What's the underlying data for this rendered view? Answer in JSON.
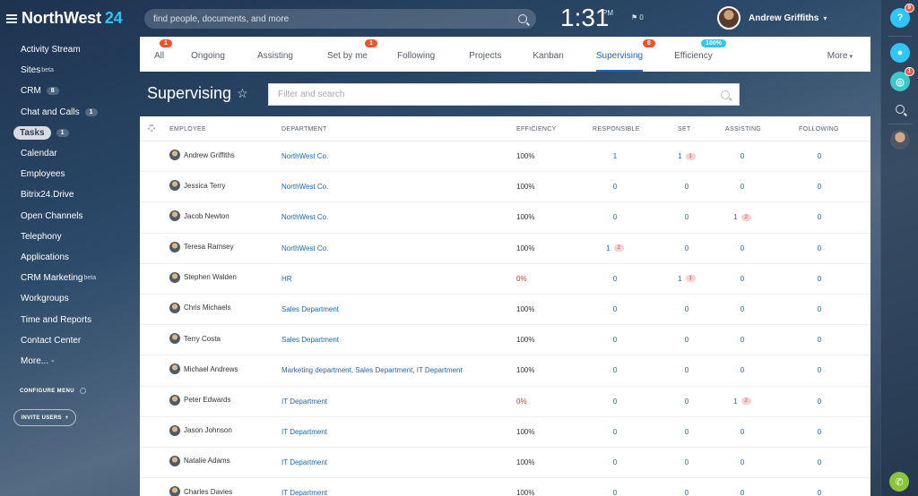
{
  "header": {
    "logo_name": "NorthWest",
    "logo_num": "24",
    "search_placeholder": "find people, documents, and more",
    "clock": "1:31",
    "ampm": "PM",
    "flag_count": "0",
    "user_name": "Andrew Griffiths"
  },
  "menu": [
    {
      "label": "Activity Stream"
    },
    {
      "label": "Sites",
      "sup": "beta"
    },
    {
      "label": "CRM",
      "count": "8"
    },
    {
      "label": "Chat and Calls",
      "count": "1"
    },
    {
      "label": "Tasks",
      "count": "1",
      "active": true
    },
    {
      "label": "Calendar"
    },
    {
      "label": "Employees"
    },
    {
      "label": "Bitrix24.Drive"
    },
    {
      "label": "Open Channels"
    },
    {
      "label": "Telephony"
    },
    {
      "label": "Applications"
    },
    {
      "label": "CRM Marketing",
      "sup": "beta"
    },
    {
      "label": "Workgroups"
    },
    {
      "label": "Time and Reports"
    },
    {
      "label": "Contact Center"
    },
    {
      "label": "More...",
      "caret": "-"
    }
  ],
  "configure_menu": "CONFIGURE MENU",
  "invite_users": "INVITE USERS",
  "invite_plus": "+",
  "tabs": [
    {
      "label": "All",
      "badge": "1"
    },
    {
      "label": "Ongoing"
    },
    {
      "label": "Assisting"
    },
    {
      "label": "Set by me",
      "badge": "1"
    },
    {
      "label": "Following"
    },
    {
      "label": "Projects"
    },
    {
      "label": "Kanban"
    },
    {
      "label": "Supervising",
      "badge": "8",
      "active": true
    },
    {
      "label": "Efficiency",
      "badge": "100%",
      "badge_color": "blue"
    },
    {
      "label": "More",
      "caret": "▾"
    }
  ],
  "page": {
    "title": "Supervising",
    "filter_placeholder": "Filter and search"
  },
  "right_bar": {
    "help_badge": "9",
    "chat_badge": "1"
  },
  "table": {
    "headers": [
      "EMPLOYEE",
      "DEPARTMENT",
      "EFFICIENCY",
      "RESPONSIBLE",
      "SET",
      "ASSISTING",
      "FOLLOWING"
    ],
    "rows": [
      {
        "employee": "Andrew Griffiths",
        "department": "NorthWest Co.",
        "efficiency": "100%",
        "responsible": "1",
        "set": "1",
        "set_pill": "1",
        "assisting": "0",
        "following": "0"
      },
      {
        "employee": "Jessica Terry",
        "department": "NorthWest Co.",
        "efficiency": "100%",
        "responsible": "0",
        "set": "0",
        "assisting": "0",
        "following": "0"
      },
      {
        "employee": "Jacob Newton",
        "department": "NorthWest Co.",
        "efficiency": "100%",
        "responsible": "0",
        "set": "0",
        "assisting": "1",
        "assisting_pill": "2",
        "following": "0"
      },
      {
        "employee": "Teresa Ramsey",
        "department": "NorthWest Co.",
        "efficiency": "100%",
        "responsible": "1",
        "responsible_pill": "2",
        "set": "0",
        "assisting": "0",
        "following": "0"
      },
      {
        "employee": "Stephen Walden",
        "department": "HR",
        "efficiency": "0%",
        "eff_red": true,
        "responsible": "0",
        "set": "1",
        "set_pill": "1",
        "assisting": "0",
        "following": "0"
      },
      {
        "employee": "Chris Michaels",
        "department": "Sales Department",
        "efficiency": "100%",
        "responsible": "0",
        "set": "0",
        "assisting": "0",
        "following": "0"
      },
      {
        "employee": "Terry Costa",
        "department": "Sales Department",
        "efficiency": "100%",
        "responsible": "0",
        "set": "0",
        "assisting": "0",
        "following": "0"
      },
      {
        "employee": "Michael Andrews",
        "department": "Marketing department, Sales Department, IT Department",
        "efficiency": "100%",
        "responsible": "0",
        "set": "0",
        "assisting": "0",
        "following": "0"
      },
      {
        "employee": "Peter Edwards",
        "department": "IT Department",
        "efficiency": "0%",
        "eff_red": true,
        "responsible": "0",
        "set": "0",
        "assisting": "1",
        "assisting_pill": "2",
        "following": "0"
      },
      {
        "employee": "Jason Johnson",
        "department": "IT Department",
        "efficiency": "100%",
        "responsible": "0",
        "set": "0",
        "assisting": "0",
        "following": "0"
      },
      {
        "employee": "Natalie Adams",
        "department": "IT Department",
        "efficiency": "100%",
        "responsible": "0",
        "set": "0",
        "assisting": "0",
        "following": "0"
      },
      {
        "employee": "Charles Davies",
        "department": "IT Department",
        "efficiency": "100%",
        "responsible": "0",
        "set": "0",
        "assisting": "0",
        "following": "0"
      }
    ]
  },
  "colors": {
    "accent": "#2067b0",
    "badge_red": "#f0522b",
    "badge_blue": "#2fc6f6",
    "logo_blue": "#2fc6f6",
    "phone_green": "#8bc53f"
  }
}
